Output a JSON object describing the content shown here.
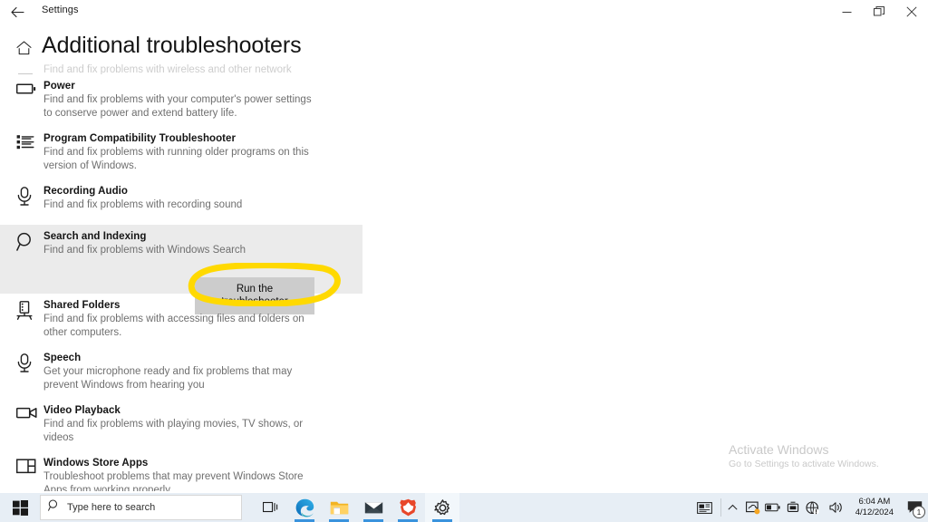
{
  "window": {
    "app_name": "Settings",
    "back_icon": "back-arrow-icon",
    "controls": {
      "minimize": "minimize-icon",
      "restore": "restore-icon",
      "close": "close-icon"
    }
  },
  "page": {
    "home_icon": "home-icon",
    "title": "Additional troubleshooters"
  },
  "troubleshooters": [
    {
      "icon": "network-adapter-icon",
      "title": "",
      "desc": "Find and fix problems with wireless and other network adapters.",
      "partial": true,
      "selected": false,
      "action": null
    },
    {
      "icon": "battery-icon",
      "title": "Power",
      "desc": "Find and fix problems with your computer's power settings to conserve power and extend battery life.",
      "partial": false,
      "selected": false,
      "action": null
    },
    {
      "icon": "list-icon",
      "title": "Program Compatibility Troubleshooter",
      "desc": "Find and fix problems with running older programs on this version of Windows.",
      "partial": false,
      "selected": false,
      "action": null
    },
    {
      "icon": "microphone-icon",
      "title": "Recording Audio",
      "desc": "Find and fix problems with recording sound",
      "partial": false,
      "selected": false,
      "action": null
    },
    {
      "icon": "search-icon",
      "title": "Search and Indexing",
      "desc": "Find and fix problems with Windows Search",
      "partial": false,
      "selected": true,
      "action": "Run the troubleshooter"
    },
    {
      "icon": "server-icon",
      "title": "Shared Folders",
      "desc": "Find and fix problems with accessing files and folders on other computers.",
      "partial": false,
      "selected": false,
      "action": null
    },
    {
      "icon": "microphone-icon",
      "title": "Speech",
      "desc": "Get your microphone ready and fix problems that may prevent Windows from hearing you",
      "partial": false,
      "selected": false,
      "action": null
    },
    {
      "icon": "video-camera-icon",
      "title": "Video Playback",
      "desc": "Find and fix problems with playing movies, TV shows, or videos",
      "partial": false,
      "selected": false,
      "action": null
    },
    {
      "icon": "app-window-icon",
      "title": "Windows Store Apps",
      "desc": "Troubleshoot problems that may prevent Windows Store Apps from working properly",
      "partial": false,
      "selected": false,
      "action": null
    }
  ],
  "annotation": {
    "type": "hand-drawn-ellipse",
    "color": "#FFD900",
    "target": "Run the troubleshooter"
  },
  "watermark": {
    "title": "Activate Windows",
    "subtitle": "Go to Settings to activate Windows."
  },
  "taskbar": {
    "start_icon": "windows-start-icon",
    "search": {
      "icon": "search-icon",
      "placeholder": "Type here to search",
      "value": ""
    },
    "items": [
      {
        "icon": "task-view-icon",
        "label": "Task View",
        "active": false,
        "running": false
      },
      {
        "icon": "edge-browser-icon",
        "label": "Microsoft Edge",
        "active": false,
        "running": true
      },
      {
        "icon": "file-explorer-icon",
        "label": "File Explorer",
        "active": false,
        "running": true
      },
      {
        "icon": "mail-icon",
        "label": "Mail",
        "active": false,
        "running": true
      },
      {
        "icon": "brave-browser-icon",
        "label": "Brave",
        "active": false,
        "running": true
      },
      {
        "icon": "gear-icon",
        "label": "Settings",
        "active": true,
        "running": true
      }
    ],
    "tray": [
      {
        "icon": "news-and-interests-icon"
      },
      {
        "icon": "chevron-up-icon"
      },
      {
        "icon": "onedrive-sync-icon"
      },
      {
        "icon": "battery-icon"
      },
      {
        "icon": "remote-desktop-icon"
      },
      {
        "icon": "network-warning-icon"
      },
      {
        "icon": "volume-icon"
      }
    ],
    "clock": {
      "time": "6:04 AM",
      "date": "4/12/2024"
    },
    "notifications": {
      "icon": "action-center-icon",
      "count": "1"
    }
  }
}
